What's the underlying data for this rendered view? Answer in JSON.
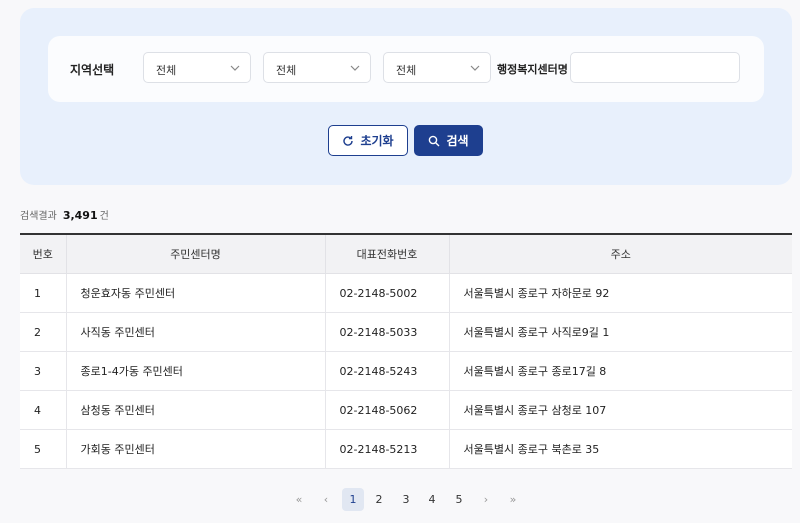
{
  "filter": {
    "region_label": "지역선택",
    "select1": "전체",
    "select2": "전체",
    "select3": "전체",
    "center_label": "행정복지센터명",
    "center_value": ""
  },
  "buttons": {
    "reset": "초기화",
    "search": "검색"
  },
  "result": {
    "label": "검색결과",
    "count": "3,491",
    "unit": "건"
  },
  "table": {
    "headers": [
      "번호",
      "주민센터명",
      "대표전화번호",
      "주소"
    ],
    "rows": [
      [
        "1",
        "청운효자동 주민센터",
        "02-2148-5002",
        "서울특별시 종로구 자하문로 92"
      ],
      [
        "2",
        "사직동 주민센터",
        "02-2148-5033",
        "서울특별시 종로구 사직로9길 1"
      ],
      [
        "3",
        "종로1-4가동 주민센터",
        "02-2148-5243",
        "서울특별시 종로구 종로17길 8"
      ],
      [
        "4",
        "삼청동 주민센터",
        "02-2148-5062",
        "서울특별시 종로구 삼청로 107"
      ],
      [
        "5",
        "가회동 주민센터",
        "02-2148-5213",
        "서울특별시 종로구 북촌로 35"
      ]
    ]
  },
  "pagination": {
    "first": "«",
    "prev": "‹",
    "pages": [
      "1",
      "2",
      "3",
      "4",
      "5"
    ],
    "current": "1",
    "next": "›",
    "last": "»"
  }
}
